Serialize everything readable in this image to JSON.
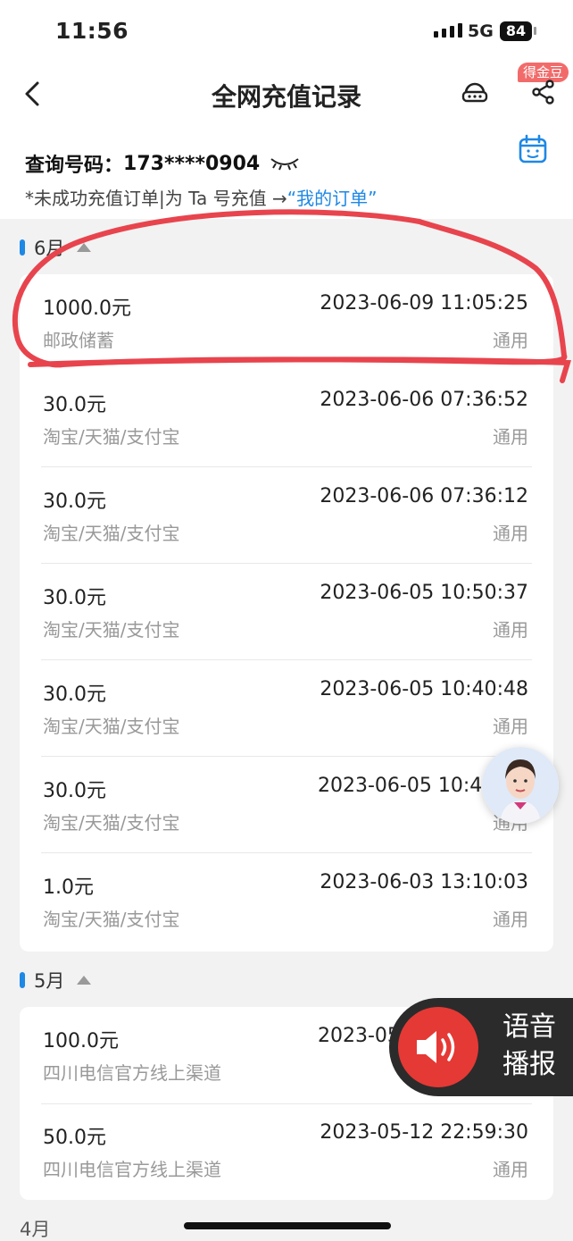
{
  "status_bar": {
    "time": "11:56",
    "network": "5G",
    "battery": "84"
  },
  "nav": {
    "title": "全网充值记录",
    "badge": "得金豆"
  },
  "query": {
    "label": "查询号码：",
    "number": "173****0904",
    "tip_prefix": "*未成功充值订单|为 Ta 号充值 →",
    "tip_link": "“我的订单”"
  },
  "months": [
    {
      "label": "6月",
      "records": [
        {
          "amount": "1000.0元",
          "datetime": "2023-06-09 11:05:25",
          "channel": "邮政储蓄",
          "tag": "通用"
        },
        {
          "amount": "30.0元",
          "datetime": "2023-06-06 07:36:52",
          "channel": "淘宝/天猫/支付宝",
          "tag": "通用"
        },
        {
          "amount": "30.0元",
          "datetime": "2023-06-06 07:36:12",
          "channel": "淘宝/天猫/支付宝",
          "tag": "通用"
        },
        {
          "amount": "30.0元",
          "datetime": "2023-06-05 10:50:37",
          "channel": "淘宝/天猫/支付宝",
          "tag": "通用"
        },
        {
          "amount": "30.0元",
          "datetime": "2023-06-05 10:40:48",
          "channel": "淘宝/天猫/支付宝",
          "tag": "通用"
        },
        {
          "amount": "30.0元",
          "datetime": "2023-06-05 10:4",
          "channel": "淘宝/天猫/支付宝",
          "tag": "通用"
        },
        {
          "amount": "1.0元",
          "datetime": "2023-06-03 13:10:03",
          "channel": "淘宝/天猫/支付宝",
          "tag": "通用"
        }
      ]
    },
    {
      "label": "5月",
      "records": [
        {
          "amount": "100.0元",
          "datetime": "2023-05",
          "channel": "四川电信官方线上渠道",
          "tag": ""
        },
        {
          "amount": "50.0元",
          "datetime": "2023-05-12 22:59:30",
          "channel": "四川电信官方线上渠道",
          "tag": "通用"
        }
      ]
    },
    {
      "label": "4月"
    }
  ],
  "voice": {
    "line1": "语音",
    "line2": "播报"
  },
  "colors": {
    "accent": "#1e88e5",
    "annotation": "#e8444d",
    "voice_button": "#e53935"
  }
}
